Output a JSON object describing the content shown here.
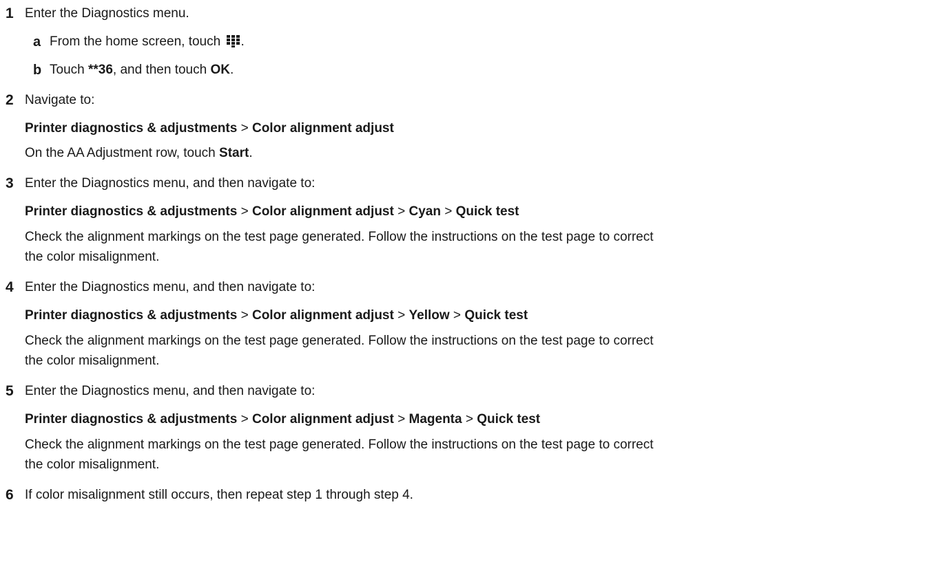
{
  "steps": [
    {
      "num": "1",
      "text": "Enter the Diagnostics menu.",
      "substeps": [
        {
          "letter": "a",
          "pre": "From the home screen, touch ",
          "icon": "keypad-icon",
          "post": "."
        },
        {
          "letter": "b",
          "pre": "Touch ",
          "b1": "**36",
          "mid": ", and then touch ",
          "b2": "OK",
          "post": "."
        }
      ]
    },
    {
      "num": "2",
      "text": "Navigate to:",
      "path": [
        "Printer diagnostics & adjustments",
        "Color alignment adjust"
      ],
      "note_pre": "On the AA Adjustment row, touch ",
      "note_bold": "Start",
      "note_post": "."
    },
    {
      "num": "3",
      "text": "Enter the Diagnostics menu, and then navigate to:",
      "path": [
        "Printer diagnostics & adjustments",
        "Color alignment adjust",
        "Cyan",
        "Quick test"
      ],
      "note_line1": "Check the alignment markings on the test page generated. Follow the instructions on the test page to correct",
      "note_line2": "the color misalignment."
    },
    {
      "num": "4",
      "text": "Enter the Diagnostics menu, and then navigate to:",
      "path": [
        "Printer diagnostics & adjustments",
        "Color alignment adjust",
        "Yellow",
        "Quick test"
      ],
      "note_line1": "Check the alignment markings on the test page generated. Follow the instructions on the test page to correct",
      "note_line2": "the color misalignment."
    },
    {
      "num": "5",
      "text": "Enter the Diagnostics menu, and then navigate to:",
      "path": [
        "Printer diagnostics & adjustments",
        "Color alignment adjust",
        "Magenta",
        "Quick test"
      ],
      "note_line1": "Check the alignment markings on the test page generated. Follow the instructions on the test page to correct",
      "note_line2": "the color misalignment."
    },
    {
      "num": "6",
      "text": "If color misalignment still occurs, then repeat step 1 through step 4."
    }
  ],
  "separator": ">"
}
